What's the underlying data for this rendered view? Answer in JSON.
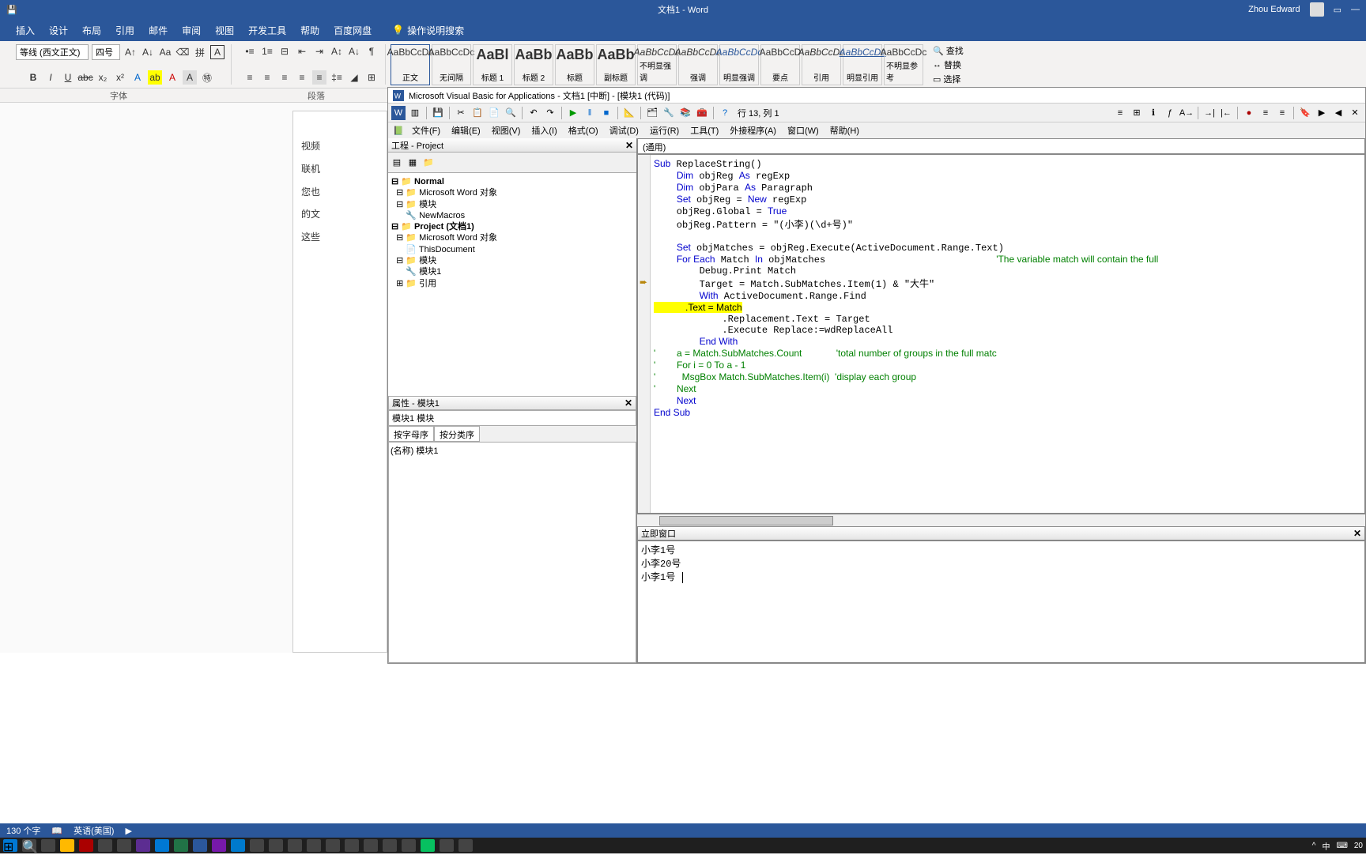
{
  "word": {
    "title": "文档1 - Word",
    "user": "Zhou Edward",
    "tabs": [
      "插入",
      "设计",
      "布局",
      "引用",
      "邮件",
      "审阅",
      "视图",
      "开发工具",
      "帮助",
      "百度网盘"
    ],
    "tell": "操作说明搜索",
    "font": {
      "name": "等线 (西文正文)",
      "size": "四号"
    },
    "group_labels": {
      "font": "字体",
      "para": "段落"
    },
    "styles": [
      {
        "sample": "AaBbCcDc",
        "label": "正文",
        "sel": true
      },
      {
        "sample": "AaBbCcDc",
        "label": "无间隔"
      },
      {
        "sample": "AaBl",
        "label": "标题 1",
        "big": true
      },
      {
        "sample": "AaBb",
        "label": "标题 2",
        "big": true
      },
      {
        "sample": "AaBb",
        "label": "标题",
        "big": true
      },
      {
        "sample": "AaBb",
        "label": "副标题",
        "big": true
      },
      {
        "sample": "AaBbCcDc",
        "label": "不明显强调",
        "italic": true
      },
      {
        "sample": "AaBbCcDc",
        "label": "强调",
        "italic": true
      },
      {
        "sample": "AaBbCcDc",
        "label": "明显强调",
        "italic": true,
        "blue": true
      },
      {
        "sample": "AaBbCcD",
        "label": "要点",
        "bold": true
      },
      {
        "sample": "AaBbCcDc",
        "label": "引用",
        "italic": true
      },
      {
        "sample": "AaBbCcDc",
        "label": "明显引用",
        "italic": true,
        "blue": true,
        "underline": true
      },
      {
        "sample": "AaBbCcDc",
        "label": "不明显参考"
      }
    ],
    "edit": {
      "find": "查找",
      "replace": "替换",
      "select": "选择"
    },
    "doc_lines": [
      "视频",
      "联机",
      "您也",
      "的文",
      "这些"
    ],
    "status": {
      "words": "130 个字",
      "lang": "英语(美国)"
    }
  },
  "vba": {
    "title": "Microsoft Visual Basic for Applications - 文档1 [中断] - [模块1 (代码)]",
    "pos": "行 13, 列 1",
    "menu": [
      "文件(F)",
      "编辑(E)",
      "视图(V)",
      "插入(I)",
      "格式(O)",
      "调试(D)",
      "运行(R)",
      "工具(T)",
      "外接程序(A)",
      "窗口(W)",
      "帮助(H)"
    ],
    "project_title": "工程 - Project",
    "tree": [
      "⊟ 📁 Normal",
      "  ⊟ 📁 Microsoft Word 对象",
      "  ⊟ 📁 模块",
      "      🔧 NewMacros",
      "⊟ 📁 Project (文档1)",
      "  ⊟ 📁 Microsoft Word 对象",
      "      📄 ThisDocument",
      "  ⊟ 📁 模块",
      "      🔧 模块1",
      "  ⊞ 📁 引用"
    ],
    "props_title": "属性 - 模块1",
    "props_combo": "模块1 模块",
    "props_tabs": [
      "按字母序",
      "按分类序"
    ],
    "props_row": "(名称) 模块1",
    "code_combo": "(通用)",
    "immediate_title": "立即窗口",
    "immediate": [
      "小李1号",
      "小李20号",
      "小李1号"
    ],
    "code": {
      "l1": "Sub ReplaceString()",
      "l2": "    Dim objReg As regExp",
      "l3": "    Dim objPara As Paragraph",
      "l4": "    Set objReg = New regExp",
      "l5": "    objReg.Global = True",
      "l6": "    objReg.Pattern = \"(小李)(\\d+号)\"",
      "l7": "",
      "l8": "    Set objMatches = objReg.Execute(ActiveDocument.Range.Text)",
      "l9a": "    For Each Match In objMatches",
      "l9b": "                              'The variable match will contain the full",
      "l10": "        Debug.Print Match",
      "l11": "        Target = Match.SubMatches.Item(1) & \"大牛\"",
      "l12": "        With ActiveDocument.Range.Find",
      "l13": "            .Text = Match",
      "l14": "            .Replacement.Text = Target",
      "l15": "            .Execute Replace:=wdReplaceAll",
      "l16": "        End With",
      "l17a": "'        a = Match.SubMatches.Count",
      "l17b": "             'total number of groups in the full matc",
      "l18": "'        For i = 0 To a - 1",
      "l19a": "'          MsgBox Match.SubMatches.Item(i)",
      "l19b": "  'display each group",
      "l20": "'        Next",
      "l21": "    Next",
      "l22": "End Sub"
    }
  },
  "taskbar": {
    "ime": "中",
    "clock": "20"
  }
}
